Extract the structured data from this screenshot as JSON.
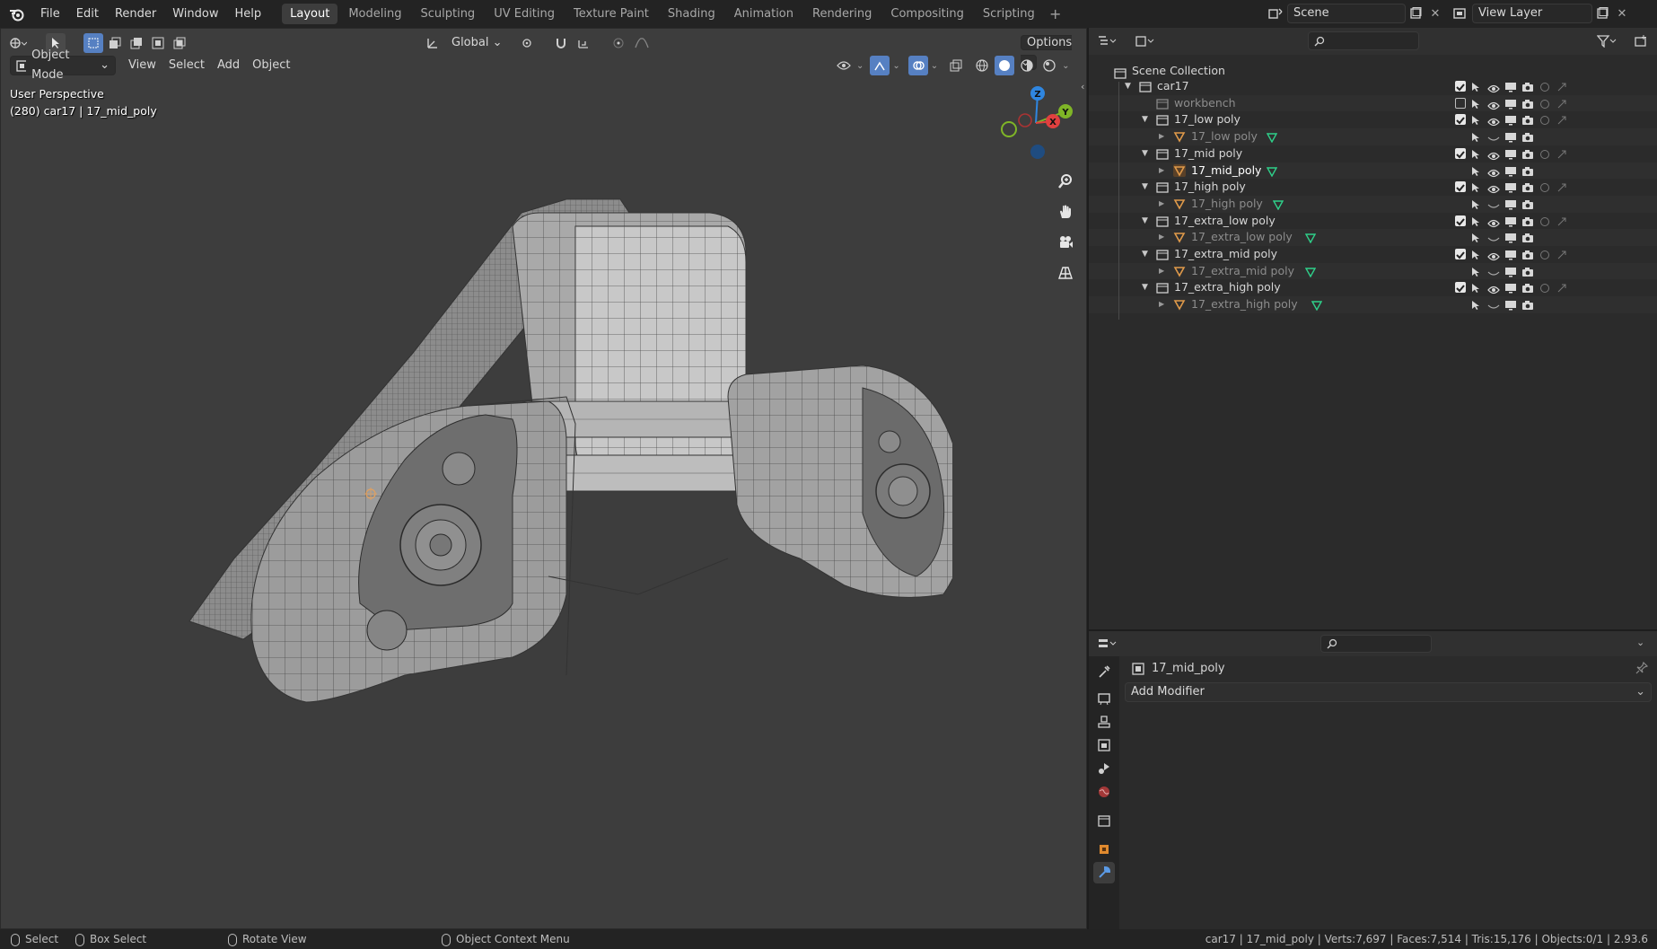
{
  "topbar": {
    "menus": [
      "File",
      "Edit",
      "Render",
      "Window",
      "Help"
    ],
    "workspaces": [
      "Layout",
      "Modeling",
      "Sculpting",
      "UV Editing",
      "Texture Paint",
      "Shading",
      "Animation",
      "Rendering",
      "Compositing",
      "Scripting"
    ],
    "active_workspace": "Layout",
    "add_workspace": "+",
    "scene_name": "Scene",
    "view_layer_name": "View Layer"
  },
  "viewport": {
    "transform_orientation": "Global",
    "options_label": "Options",
    "mode": "Object Mode",
    "menus": [
      "View",
      "Select",
      "Add",
      "Object"
    ],
    "overlay_line1": "User Perspective",
    "overlay_line2": "(280) car17 | 17_mid_poly",
    "gizmo_axes": {
      "z": "Z",
      "y": "Y",
      "x": "X"
    },
    "colors": {
      "x_axis": "#e0403f",
      "y_axis": "#7fb527",
      "z_axis": "#2f86e0"
    }
  },
  "outliner": {
    "root": "Scene Collection",
    "rows": [
      {
        "label": "car17",
        "type": "collection",
        "depth": 1,
        "expanded": true,
        "checked": true,
        "dim": false
      },
      {
        "label": "workbench",
        "type": "collection",
        "depth": 2,
        "expanded": false,
        "checked": false,
        "dim": true
      },
      {
        "label": "17_low poly",
        "type": "collection",
        "depth": 2,
        "expanded": true,
        "checked": true,
        "dim": false
      },
      {
        "label": "17_low poly",
        "type": "mesh",
        "depth": 3,
        "dim": true
      },
      {
        "label": "17_mid poly",
        "type": "collection",
        "depth": 2,
        "expanded": true,
        "checked": true,
        "dim": false
      },
      {
        "label": "17_mid_poly",
        "type": "mesh",
        "depth": 3,
        "dim": false,
        "active": true
      },
      {
        "label": "17_high poly",
        "type": "collection",
        "depth": 2,
        "expanded": true,
        "checked": true,
        "dim": false
      },
      {
        "label": "17_high poly",
        "type": "mesh",
        "depth": 3,
        "dim": true
      },
      {
        "label": "17_extra_low poly",
        "type": "collection",
        "depth": 2,
        "expanded": true,
        "checked": true,
        "dim": false
      },
      {
        "label": "17_extra_low poly",
        "type": "mesh",
        "depth": 3,
        "dim": true
      },
      {
        "label": "17_extra_mid poly",
        "type": "collection",
        "depth": 2,
        "expanded": true,
        "checked": true,
        "dim": false
      },
      {
        "label": "17_extra_mid poly",
        "type": "mesh",
        "depth": 3,
        "dim": true
      },
      {
        "label": "17_extra_high poly",
        "type": "collection",
        "depth": 2,
        "expanded": true,
        "checked": true,
        "dim": false
      },
      {
        "label": "17_extra_high poly",
        "type": "mesh",
        "depth": 3,
        "dim": true
      }
    ]
  },
  "properties": {
    "object_name": "17_mid_poly",
    "add_modifier_label": "Add Modifier"
  },
  "statusbar": {
    "select": "Select",
    "box_select": "Box Select",
    "rotate_view": "Rotate View",
    "context_menu": "Object Context Menu",
    "stats": "car17 | 17_mid_poly | Verts:7,697 | Faces:7,514 | Tris:15,176 | Objects:0/1 | 2.93.6"
  }
}
